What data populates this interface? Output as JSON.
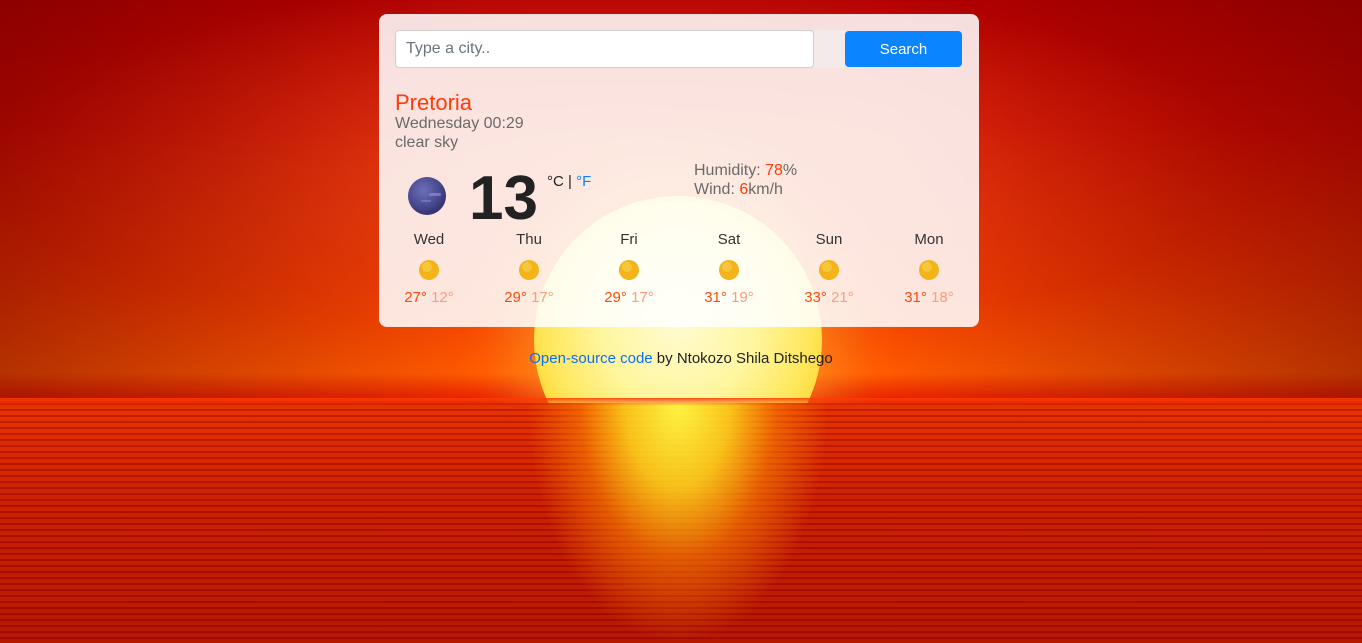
{
  "search": {
    "placeholder": "Type a city..",
    "button_label": "Search"
  },
  "current": {
    "city": "Pretoria",
    "datetime": "Wednesday 00:29",
    "description": "clear sky",
    "icon": "night-clear-moon-icon",
    "temperature": "13",
    "unit_c": "°C",
    "unit_separator": "|",
    "unit_f": "°F",
    "humidity_label": "Humidity: ",
    "humidity_value": "78",
    "humidity_unit": "%",
    "wind_label": "Wind: ",
    "wind_value": "6",
    "wind_unit": "km/h"
  },
  "forecast": [
    {
      "day": "Wed",
      "icon": "sun-icon",
      "max": "27°",
      "min": "12°"
    },
    {
      "day": "Thu",
      "icon": "sun-icon",
      "max": "29°",
      "min": "17°"
    },
    {
      "day": "Fri",
      "icon": "sun-icon",
      "max": "29°",
      "min": "17°"
    },
    {
      "day": "Sat",
      "icon": "sun-icon",
      "max": "31°",
      "min": "19°"
    },
    {
      "day": "Sun",
      "icon": "sun-icon",
      "max": "33°",
      "min": "21°"
    },
    {
      "day": "Mon",
      "icon": "sun-icon",
      "max": "31°",
      "min": "18°"
    }
  ],
  "footer": {
    "link_text": "Open-source code",
    "author_text": " by Ntokozo Shila Ditshego"
  },
  "colors": {
    "accent": "#ff3b0a",
    "button": "#0a84ff",
    "link": "#0a6eff"
  }
}
